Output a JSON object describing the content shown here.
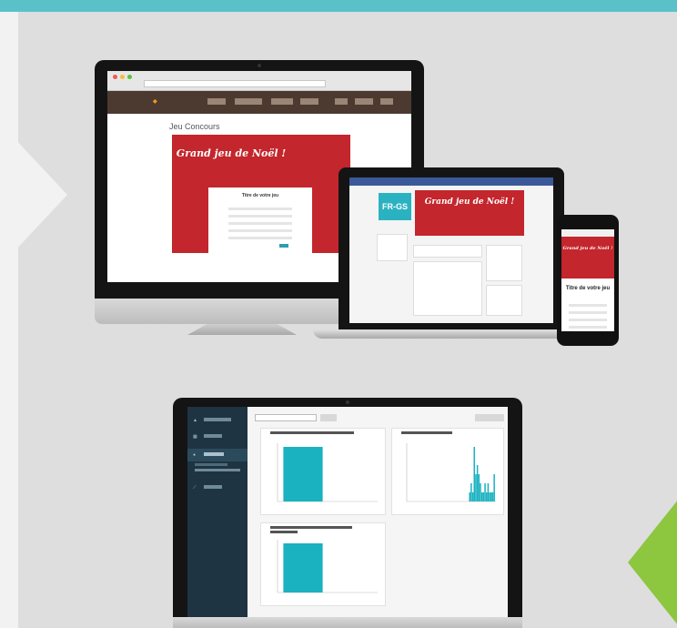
{
  "colors": {
    "accent_teal": "#5bc1c9",
    "accent_green": "#8dc63f",
    "banner_red": "#c3262c",
    "dash_sidebar": "#1f3442",
    "bar_teal": "#1ab1c0"
  },
  "desktop": {
    "page_title": "Jeu Concours",
    "banner_title": "Grand jeu de Noël !",
    "form_title": "Titre de votre jeu"
  },
  "laptop": {
    "banner_title": "Grand jeu de Noël !",
    "logo_text": "FR-GS"
  },
  "phone": {
    "banner_title": "Grand jeu de Noël !",
    "form_title": "Titre de votre jeu"
  },
  "dashboard": {
    "icons": [
      "chart-icon",
      "list-icon",
      "user-icon",
      "line-chart-icon"
    ]
  },
  "chart_data": [
    {
      "type": "bar",
      "values": [
        1,
        0
      ]
    },
    {
      "type": "bar",
      "values": [
        0,
        0,
        0,
        0,
        0,
        0,
        0,
        0,
        0,
        0,
        0,
        0,
        0,
        0,
        0,
        0,
        0,
        0,
        0,
        0,
        0,
        0,
        0,
        0,
        0,
        0,
        0,
        0,
        0,
        0,
        0,
        0,
        0,
        0,
        0,
        0,
        0,
        0,
        0,
        0,
        1,
        2,
        1,
        6,
        3,
        4,
        3,
        2,
        1,
        1,
        2,
        1,
        2,
        1,
        1,
        1,
        3
      ]
    },
    {
      "type": "bar",
      "values": [
        1,
        0
      ]
    }
  ]
}
